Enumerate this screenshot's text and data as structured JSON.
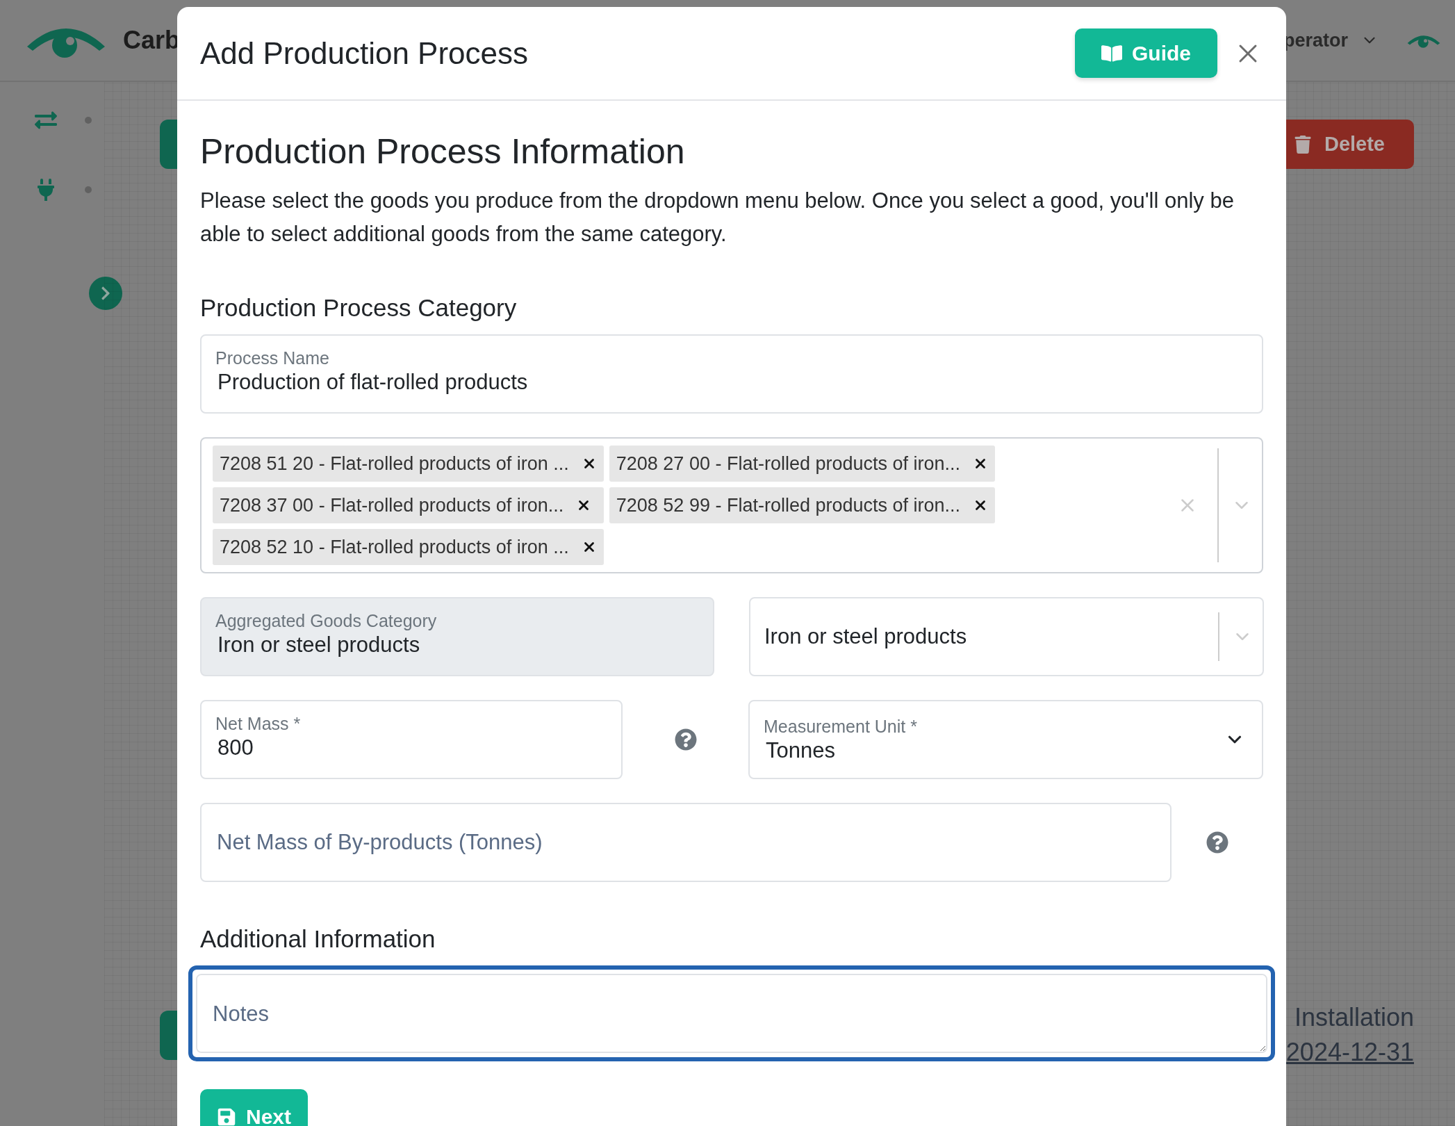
{
  "app_header": {
    "brand": "Carb",
    "user_menu": "perator"
  },
  "background": {
    "delete_button": "Delete",
    "installation_label": "Installation",
    "date_link": "2024-12-31"
  },
  "modal": {
    "title": "Add Production Process",
    "guide_button": "Guide",
    "section_title": "Production Process Information",
    "intro": "Please select the goods you produce from the dropdown menu below. Once you select a good, you'll only be able to select additional goods from the same category.",
    "category_heading": "Production Process Category",
    "process_name": {
      "label": "Process Name",
      "value": "Production of flat-rolled products"
    },
    "goods": {
      "tags": [
        {
          "label": "7208 51 20 - Flat-rolled products of iron ..."
        },
        {
          "label": "7208 27 00 - Flat-rolled products of iron..."
        },
        {
          "label": "7208 37 00 - Flat-rolled products of iron..."
        },
        {
          "label": "7208 52 99 - Flat-rolled products of iron..."
        },
        {
          "label": "7208 52 10 - Flat-rolled products of iron ..."
        }
      ]
    },
    "aggregated_category": {
      "label": "Aggregated Goods Category",
      "value": "Iron or steel products",
      "disabled": true
    },
    "category_select": {
      "value": "Iron or steel products"
    },
    "net_mass": {
      "label": "Net Mass *",
      "value": "800"
    },
    "measurement_unit": {
      "label": "Measurement Unit *",
      "value": "Tonnes"
    },
    "byproducts": {
      "placeholder": "Net Mass of By-products (Tonnes)"
    },
    "additional_heading": "Additional Information",
    "notes": {
      "placeholder": "Notes",
      "focused": true
    },
    "next_button": "Next"
  }
}
